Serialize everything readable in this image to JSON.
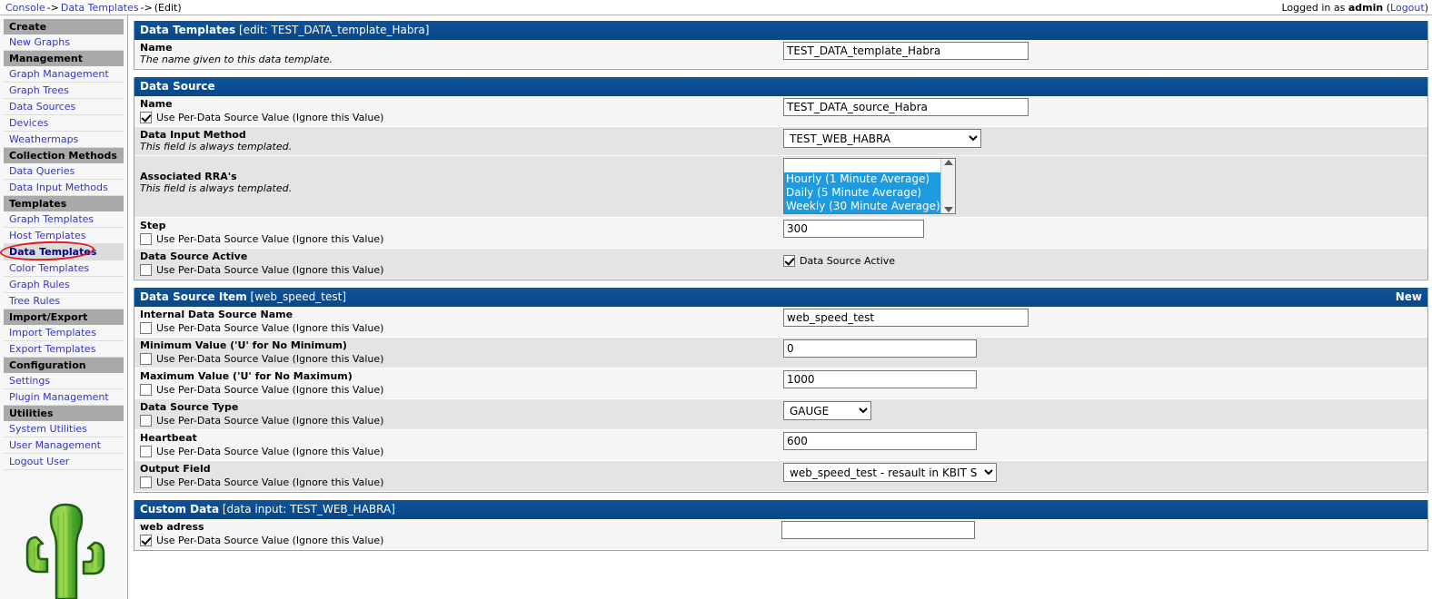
{
  "topbar": {
    "breadcrumb": [
      {
        "label": "Console",
        "link": true
      },
      {
        "label": "->",
        "link": false
      },
      {
        "label": "Data Templates",
        "link": true
      },
      {
        "label": "->",
        "link": false
      },
      {
        "label": "(Edit)",
        "link": false
      }
    ],
    "breadcrumb_console": "Console",
    "breadcrumb_sep1": "->",
    "breadcrumb_data_templates": "Data Templates",
    "breadcrumb_sep2": "->",
    "breadcrumb_edit": "(Edit)",
    "logged_in_prefix": "Logged in as",
    "logged_in_user": "admin",
    "logout_open": "(",
    "logout_label": "Logout",
    "logout_close": ")"
  },
  "sidebar": {
    "groups": [
      {
        "header": "Create",
        "items": [
          {
            "label": "New Graphs",
            "active": false
          }
        ]
      },
      {
        "header": "Management",
        "items": [
          {
            "label": "Graph Management",
            "active": false
          },
          {
            "label": "Graph Trees",
            "active": false
          },
          {
            "label": "Data Sources",
            "active": false
          },
          {
            "label": "Devices",
            "active": false
          },
          {
            "label": "Weathermaps",
            "active": false
          }
        ]
      },
      {
        "header": "Collection Methods",
        "items": [
          {
            "label": "Data Queries",
            "active": false
          },
          {
            "label": "Data Input Methods",
            "active": false
          }
        ]
      },
      {
        "header": "Templates",
        "items": [
          {
            "label": "Graph Templates",
            "active": false
          },
          {
            "label": "Host Templates",
            "active": false
          },
          {
            "label": "Data Templates",
            "active": true
          },
          {
            "label": "Color Templates",
            "active": false
          },
          {
            "label": "Graph Rules",
            "active": false
          },
          {
            "label": "Tree Rules",
            "active": false
          }
        ]
      },
      {
        "header": "Import/Export",
        "items": [
          {
            "label": "Import Templates",
            "active": false
          },
          {
            "label": "Export Templates",
            "active": false
          }
        ]
      },
      {
        "header": "Configuration",
        "items": [
          {
            "label": "Settings",
            "active": false
          },
          {
            "label": "Plugin Management",
            "active": false
          }
        ]
      },
      {
        "header": "Utilities",
        "items": [
          {
            "label": "System Utilities",
            "active": false
          },
          {
            "label": "User Management",
            "active": false
          },
          {
            "label": "Logout User",
            "active": false
          }
        ]
      }
    ],
    "logo_name": "cacti-cactus-logo"
  },
  "panels": {
    "data_templates": {
      "title_bold": "Data Templates",
      "title_rest": "[edit: TEST_DATA_template_Habra]",
      "name_label": "Name",
      "name_desc": "The name given to this data template.",
      "name_value": "TEST_DATA_template_Habra"
    },
    "data_source": {
      "title_bold": "Data Source",
      "title_rest": "",
      "name_label": "Name",
      "name_checkbox_label": "Use Per-Data Source Value (Ignore this Value)",
      "name_checked": true,
      "name_value": "TEST_DATA_source_Habra",
      "input_method_label": "Data Input Method",
      "input_method_desc": "This field is always templated.",
      "input_method_value": "TEST_WEB_HABRA",
      "input_method_options": [
        "TEST_WEB_HABRA"
      ],
      "rra_label": "Associated RRA's",
      "rra_desc": "This field is always templated.",
      "rra_options": [
        {
          "label": "",
          "selected": false
        },
        {
          "label": "Hourly (1 Minute Average)",
          "selected": true
        },
        {
          "label": "Daily (5 Minute Average)",
          "selected": true
        },
        {
          "label": "Weekly (30 Minute Average)",
          "selected": true
        }
      ],
      "step_label": "Step",
      "step_checkbox_label": "Use Per-Data Source Value (Ignore this Value)",
      "step_checked": false,
      "step_value": "300",
      "active_label": "Data Source Active",
      "active_checkbox_label": "Use Per-Data Source Value (Ignore this Value)",
      "active_checked": false,
      "active_field_label": "Data Source Active",
      "active_field_checked": true
    },
    "data_source_item": {
      "title_bold": "Data Source Item",
      "title_rest": "[web_speed_test]",
      "new_link": "New",
      "internal_name_label": "Internal Data Source Name",
      "internal_name_checkbox_label": "Use Per-Data Source Value (Ignore this Value)",
      "internal_name_checked": false,
      "internal_name_value": "web_speed_test",
      "min_label": "Minimum Value ('U' for No Minimum)",
      "min_checkbox_label": "Use Per-Data Source Value (Ignore this Value)",
      "min_checked": false,
      "min_value": "0",
      "max_label": "Maximum Value ('U' for No Maximum)",
      "max_checkbox_label": "Use Per-Data Source Value (Ignore this Value)",
      "max_checked": false,
      "max_value": "1000",
      "type_label": "Data Source Type",
      "type_checkbox_label": "Use Per-Data Source Value (Ignore this Value)",
      "type_checked": false,
      "type_value": "GAUGE",
      "type_options": [
        "GAUGE"
      ],
      "heartbeat_label": "Heartbeat",
      "heartbeat_checkbox_label": "Use Per-Data Source Value (Ignore this Value)",
      "heartbeat_checked": false,
      "heartbeat_value": "600",
      "output_label": "Output Field",
      "output_checkbox_label": "Use Per-Data Source Value (Ignore this Value)",
      "output_checked": false,
      "output_value": "web_speed_test - resault in KBIT S",
      "output_options": [
        "web_speed_test - resault in KBIT S"
      ]
    },
    "custom_data": {
      "title_bold": "Custom Data",
      "title_rest": "[data input: TEST_WEB_HABRA]",
      "web_adress_label": "web adress",
      "web_adress_checkbox_label": "Use Per-Data Source Value (Ignore this Value)",
      "web_adress_checked": true,
      "web_adress_value": "",
      "web_adress_placeholder": ""
    }
  },
  "colors": {
    "panel_header": "#0b4d8f",
    "link": "#3333cc",
    "nav_header_bg": "#a9a9a9",
    "row_light": "#f5f5f5",
    "row_dark": "#e4e4e4",
    "select_highlight": "#1e9be0",
    "annotation": "#e01b1b"
  }
}
